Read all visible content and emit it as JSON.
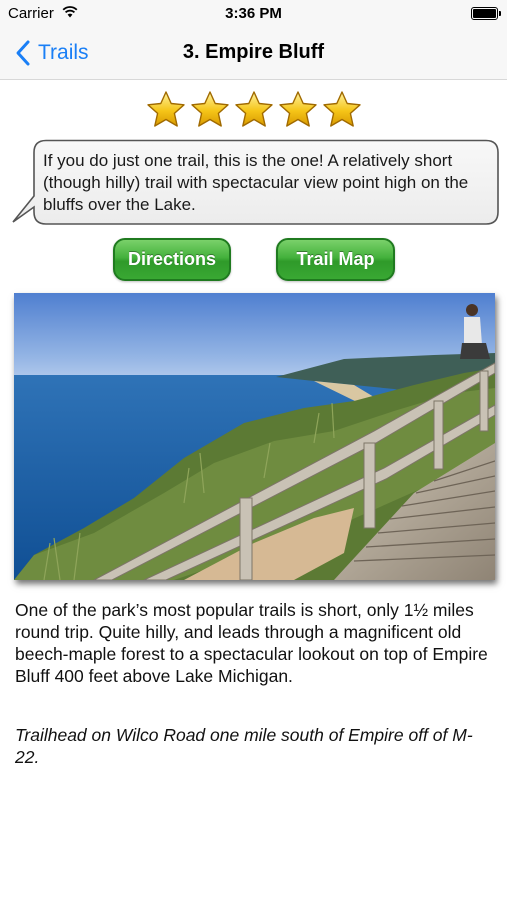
{
  "status_bar": {
    "carrier": "Carrier",
    "time": "3:36 PM",
    "wifi_icon": "wifi-icon",
    "battery_icon": "battery-icon"
  },
  "nav": {
    "back_label": "Trails",
    "back_icon": "chevron-left-icon",
    "title": "3. Empire Bluff"
  },
  "rating": {
    "stars": 5,
    "max": 5,
    "icon": "star-icon"
  },
  "summary": "If you do just one trail, this is the one! A relatively short (though hilly) trail with spectacular view point high on the bluffs over the Lake.",
  "buttons": {
    "directions": "Directions",
    "trail_map": "Trail Map"
  },
  "photo": {
    "subject": "lake-overlook-photo"
  },
  "description": "One of the park’s most popular trails is short, only 1½ miles round trip. Quite hilly, and leads through a magnificent old beech-maple forest to a spectacular lookout on top of Empire Bluff 400 feet above Lake Michigan.",
  "trailhead": "Trailhead on Wilco Road one mile south of Empire off of M-22.",
  "colors": {
    "accent_blue": "#1a7ff6",
    "button_green": "#3aa835",
    "star_gold": "#f5c518"
  }
}
